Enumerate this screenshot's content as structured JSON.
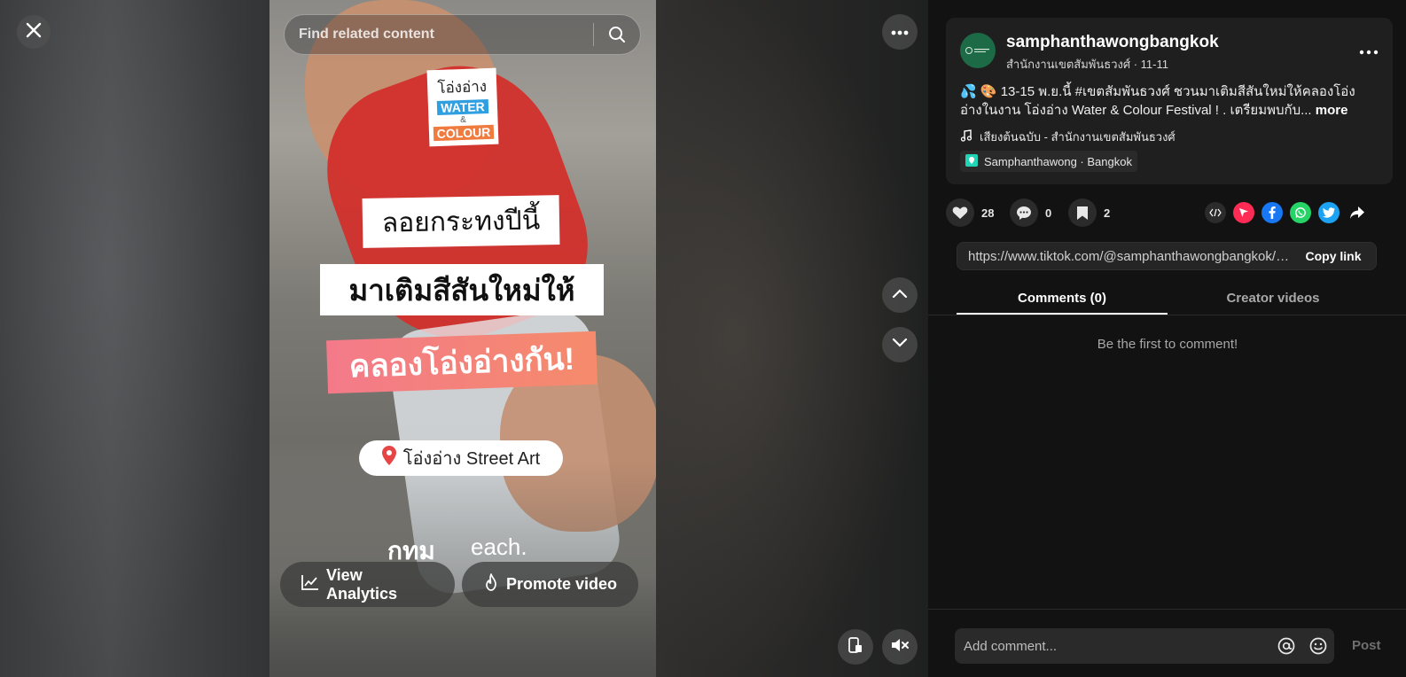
{
  "search": {
    "placeholder": "Find related content"
  },
  "video": {
    "logo": {
      "line1": "โอ่งอ่าง",
      "line2": "WATER",
      "line3": "&",
      "line4": "COLOUR"
    },
    "caption1": "ลอยกระทงปีนี้",
    "caption2": "มาเติมสีสันใหม่ให้",
    "caption3": "คลองโอ่งอ่างกัน!",
    "location_pill": "โอ่งอ่าง Street Art",
    "brand_left": "กทม",
    "brand_right": "each.",
    "analytics_label": "View Analytics",
    "promote_label": "Promote video"
  },
  "post": {
    "username": "samphanthawongbangkok",
    "subline": "สำนักงานเขตสัมพันธวงศ์ · 11-11",
    "description": "💦 🎨 13-15 พ.ย.นี้ #เขตสัมพันธวงศ์ ชวนมาเติมสีสันใหม่ให้คลองโอ่งอ่างในงาน โอ่งอ่าง Water & Colour Festival ! . เตรียมพบกับ...",
    "more_label": "more",
    "music": "เสียงต้นฉบับ - สำนักงานเขตสัมพันธวงศ์",
    "place": "Samphanthawong · Bangkok"
  },
  "stats": {
    "likes": "28",
    "comments": "0",
    "saves": "2"
  },
  "link": {
    "url": "https://www.tiktok.com/@samphanthawongbangkok/vi...",
    "copy_label": "Copy link"
  },
  "tabs": [
    {
      "label": "Comments (0)"
    },
    {
      "label": "Creator videos"
    }
  ],
  "empty_message": "Be the first to comment!",
  "comment": {
    "placeholder": "Add comment...",
    "post_label": "Post"
  },
  "colors": {
    "accent": "#fe2c55",
    "panel_bg": "#121212",
    "card_bg": "#1f1f1f",
    "facebook": "#1877f2",
    "whatsapp": "#25d366",
    "twitter": "#1da1f2"
  }
}
